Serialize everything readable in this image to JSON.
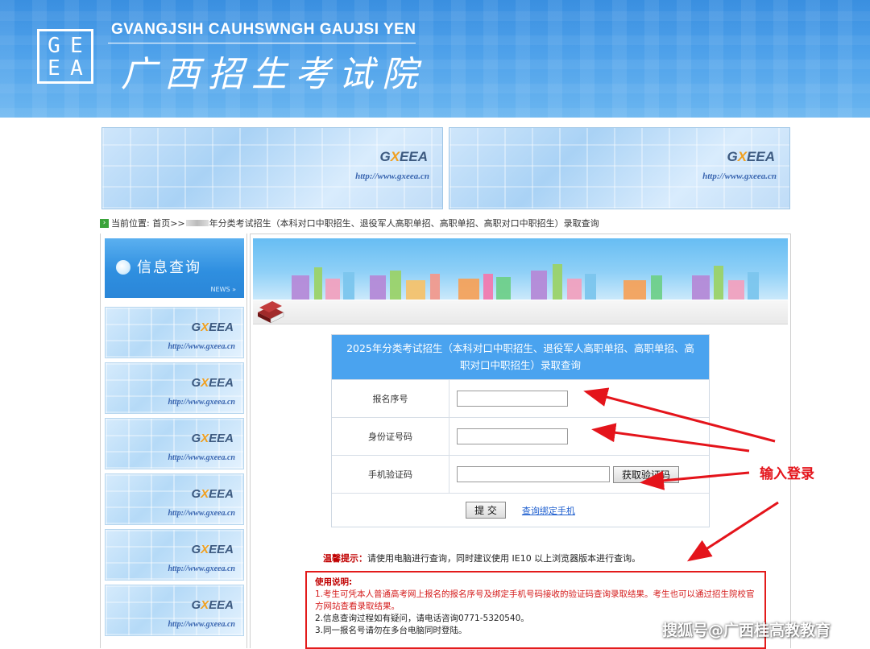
{
  "header": {
    "logo_letters": [
      "G",
      "E",
      "E",
      "A"
    ],
    "en_title": "GVANGJSIH CAUHSWNGH GAUJSI YEN",
    "cn_title": "广西招生考试院"
  },
  "banner": {
    "brand_prefix": "G",
    "brand_x": "X",
    "brand_suffix": "EEA",
    "url": "http://www.gxeea.cn"
  },
  "breadcrumb": {
    "location_label": "当前位置:",
    "home": "首页>>",
    "page": "年分类考试招生（本科对口中职招生、退役军人高职单招、高职单招、高职对口中职招生）录取查询"
  },
  "sidebar": {
    "title": "信息查询",
    "more": "NEWS »",
    "cards": [
      {
        "url": "http://www.gxeea.cn"
      },
      {
        "url": "http://www.gxeea.cn"
      },
      {
        "url": "http://www.gxeea.cn"
      },
      {
        "url": "http://www.gxeea.cn"
      },
      {
        "url": "http://www.gxeea.cn"
      },
      {
        "url": "http://www.gxeea.cn"
      }
    ]
  },
  "form": {
    "title": "2025年分类考试招生（本科对口中职招生、退役军人高职单招、高职单招、高职对口中职招生）录取查询",
    "fields": {
      "reg_label": "报名序号",
      "id_label": "身份证号码",
      "sms_label": "手机验证码"
    },
    "get_code_label": "获取验证码",
    "submit_label": "提 交",
    "bind_phone_link": "查询绑定手机"
  },
  "tip": {
    "key": "温馨提示：",
    "text": "请使用电脑进行查询，同时建议使用 IE10 以上浏览器版本进行查询。"
  },
  "notes": {
    "title": "使用说明:",
    "items": [
      "1.考生可凭本人普通高考网上报名的报名序号及绑定手机号码接收的验证码查询录取结果。考生也可以通过招生院校官方网站查看录取结果。",
      "2.信息查询过程如有疑问，请电话咨询0771-5320540。",
      "3.同一报名号请勿在多台电脑同时登陆。"
    ]
  },
  "annotation": "输入登录",
  "watermark": "搜狐号@广西桂高教教育",
  "colors": {
    "header_blue": "#3a8fe0",
    "form_head_blue": "#4aa3ef",
    "annotation_red": "#e4141b"
  }
}
